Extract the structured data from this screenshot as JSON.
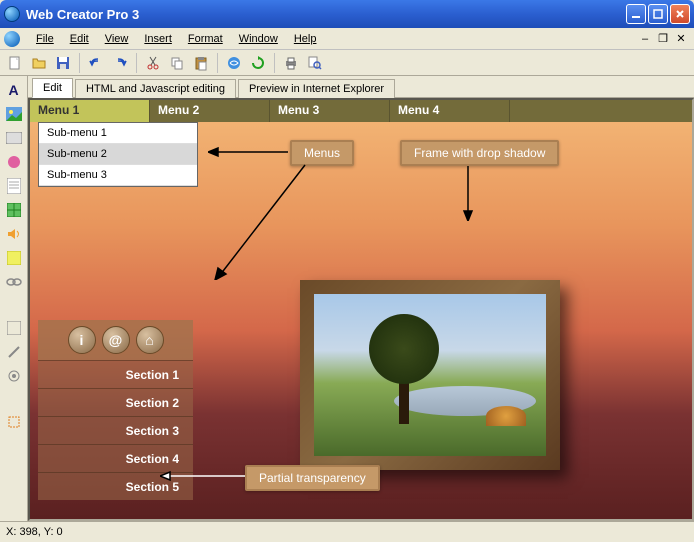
{
  "title": "Web Creator Pro 3",
  "menubar": [
    "File",
    "Edit",
    "View",
    "Insert",
    "Format",
    "Window",
    "Help"
  ],
  "tabs": [
    {
      "label": "Edit",
      "active": true
    },
    {
      "label": "HTML and Javascript editing",
      "active": false
    },
    {
      "label": "Preview in Internet Explorer",
      "active": false
    }
  ],
  "page_menu": [
    {
      "label": "Menu 1",
      "active": true
    },
    {
      "label": "Menu 2",
      "active": false
    },
    {
      "label": "Menu 3",
      "active": false
    },
    {
      "label": "Menu 4",
      "active": false
    }
  ],
  "submenu": [
    {
      "label": "Sub-menu 1",
      "hover": false
    },
    {
      "label": "Sub-menu 2",
      "hover": true
    },
    {
      "label": "Sub-menu 3",
      "hover": false
    }
  ],
  "annotations": {
    "menus": "Menus",
    "frame": "Frame with drop shadow",
    "transparency": "Partial transparency"
  },
  "side_panel": {
    "icons": [
      "i",
      "@",
      "⌂"
    ],
    "sections": [
      "Section 1",
      "Section 2",
      "Section 3",
      "Section 4",
      "Section 5"
    ]
  },
  "status": "X: 398, Y: 0"
}
